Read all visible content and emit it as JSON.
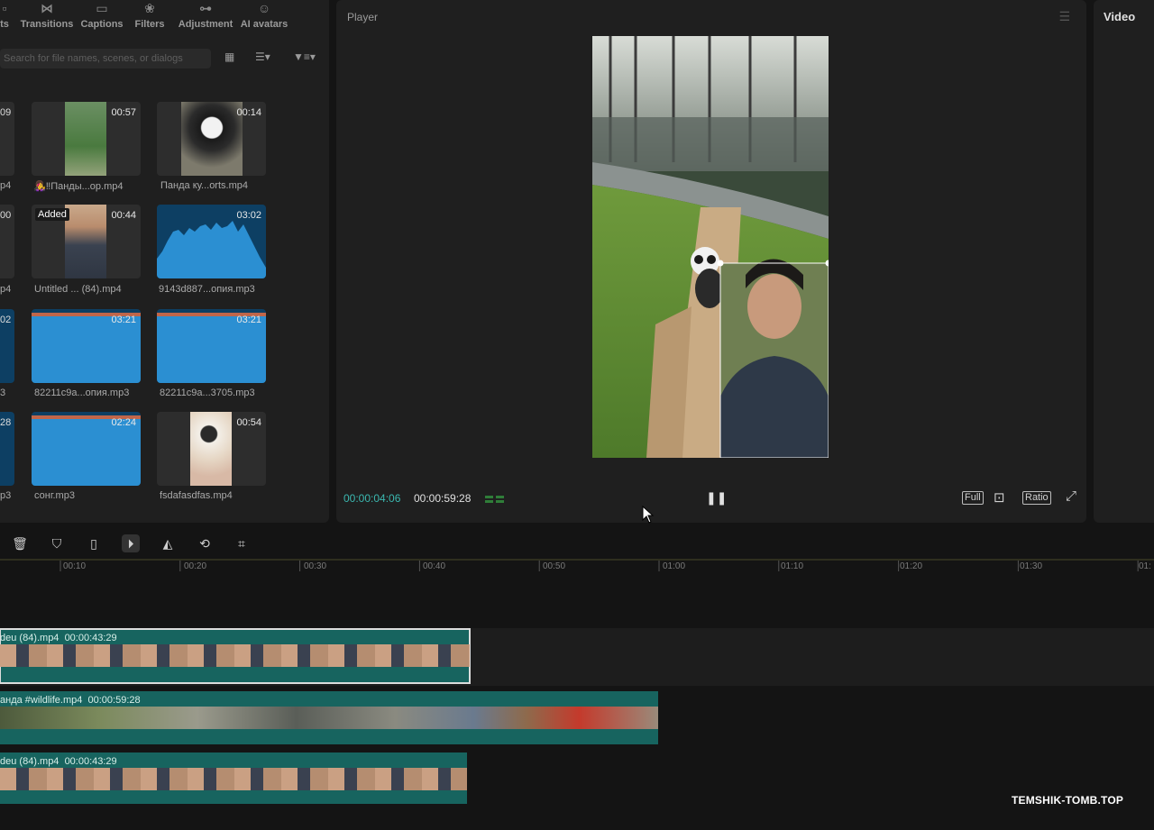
{
  "top_tabs": [
    {
      "label": "ts",
      "icon": "partial-icon"
    },
    {
      "label": "Transitions",
      "icon": "transitions-icon"
    },
    {
      "label": "Captions",
      "icon": "captions-icon"
    },
    {
      "label": "Filters",
      "icon": "filters-icon"
    },
    {
      "label": "Adjustment",
      "icon": "adjustment-icon"
    },
    {
      "label": "AI avatars",
      "icon": "ai-avatar-icon"
    }
  ],
  "search": {
    "placeholder": "Search for file names, scenes, or dialogs"
  },
  "media": {
    "edge_items": [
      {
        "text": "09"
      },
      {
        "text": "p4"
      },
      {
        "text": "00"
      },
      {
        "text": "p4"
      },
      {
        "text": "02"
      },
      {
        "text": "3"
      },
      {
        "text": "28"
      },
      {
        "text": "p3"
      }
    ],
    "items": [
      {
        "name": "👩‍🎤‼Панды...ор.mp4",
        "duration": "00:57",
        "type": "video",
        "added": ""
      },
      {
        "name": "Панда ку...orts.mp4",
        "duration": "00:14",
        "type": "video",
        "added": ""
      },
      {
        "name": "Untitled ... (84).mp4",
        "duration": "00:44",
        "type": "video",
        "added": "Added"
      },
      {
        "name": "9143d887...опия.mp3",
        "duration": "03:02",
        "type": "audio",
        "added": ""
      },
      {
        "name": "82211c9a...опия.mp3",
        "duration": "03:21",
        "type": "audio",
        "added": ""
      },
      {
        "name": "82211c9a...3705.mp3",
        "duration": "03:21",
        "type": "audio",
        "added": ""
      },
      {
        "name": "сонг.mp3",
        "duration": "02:24",
        "type": "audio",
        "added": ""
      },
      {
        "name": "fsdafasdfas.mp4",
        "duration": "00:54",
        "type": "video",
        "added": ""
      }
    ]
  },
  "player": {
    "title": "Player",
    "current_time": "00:00:04:06",
    "total_time": "00:00:59:28",
    "buttons": {
      "full": "Full",
      "ratio": "Ratio"
    }
  },
  "properties": {
    "title": "Video"
  },
  "timeline": {
    "ruler_labels": [
      "00:10",
      "00:20",
      "00:30",
      "00:40",
      "00:50",
      "01:00",
      "01:10",
      "01:20",
      "01:30",
      "01:"
    ],
    "clips": [
      {
        "name": "deu (84).mp4",
        "duration": "00:00:43:29"
      },
      {
        "name": "анда #wildlife.mp4",
        "duration": "00:00:59:28"
      },
      {
        "name": "deu (84).mp4",
        "duration": "00:00:43:29"
      }
    ]
  },
  "watermark": "TEMSHIK-TOMB.TOP",
  "colors": {
    "accent": "#3bb8b0",
    "clip": "#17645f",
    "audio_tile": "#0d3f63"
  }
}
